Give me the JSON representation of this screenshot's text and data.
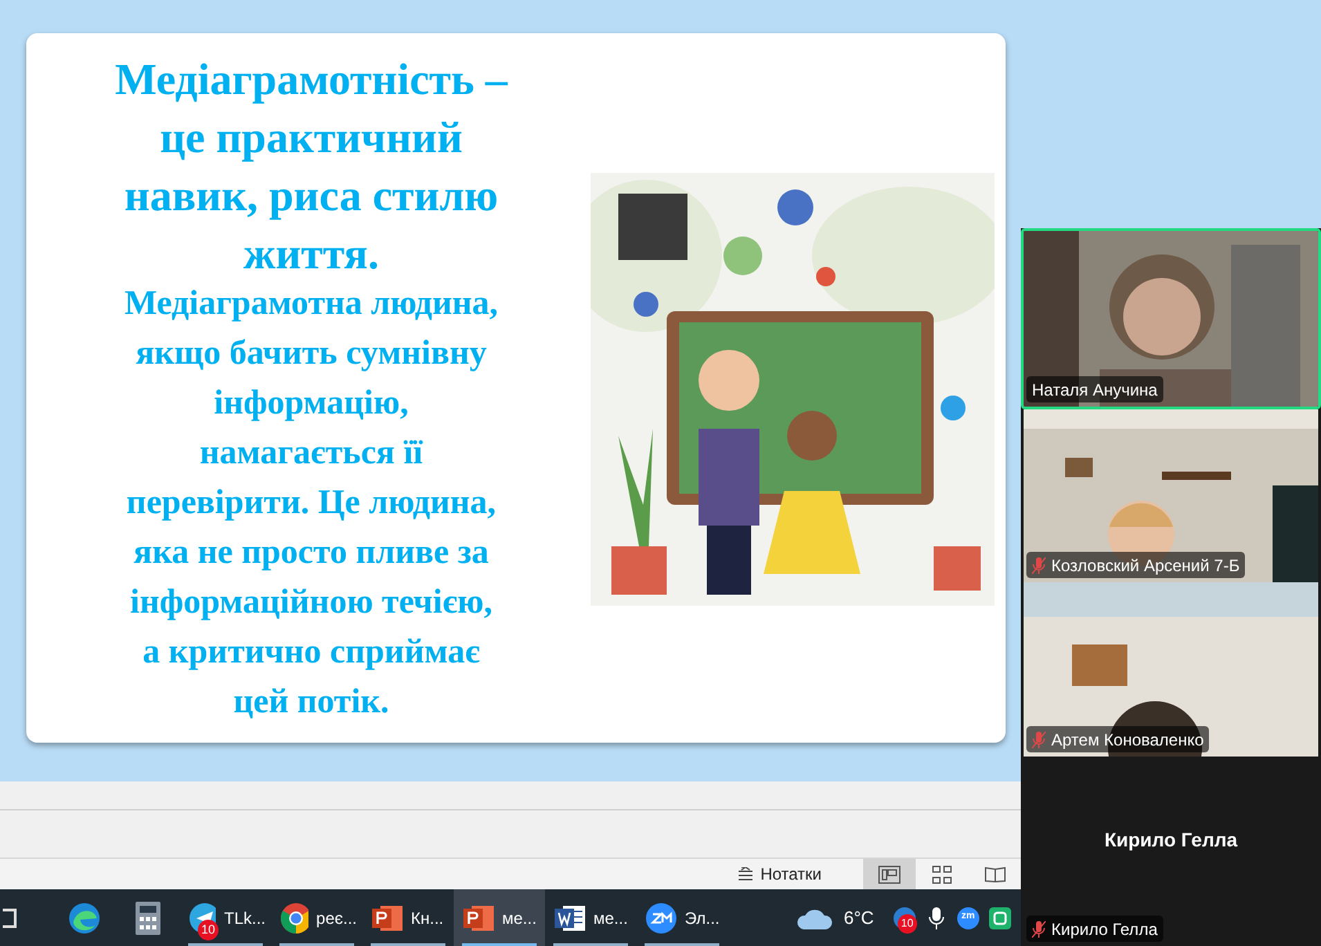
{
  "slide": {
    "heading_lines": [
      "Медіаграмотність –",
      "це практичний",
      "навик, риса стилю",
      "життя."
    ],
    "body_lines": [
      "Медіаграмотна людина,",
      "якщо бачить сумнівну",
      "інформацію,",
      "намагається її",
      "перевірити. Це людина,",
      "яка не просто пливе за",
      "інформаційною течією,",
      "а критично сприймає",
      "цей потік."
    ]
  },
  "status_bar": {
    "notes_label": "Нотатки",
    "views": [
      {
        "kind": "normal",
        "selected": true
      },
      {
        "kind": "sorter",
        "selected": false
      },
      {
        "kind": "reading",
        "selected": false
      }
    ]
  },
  "participants": [
    {
      "name": "Наталя Анучина",
      "muted": false,
      "speaking": true,
      "kind": "video"
    },
    {
      "name": "Козловский Арсений 7-Б",
      "muted": true,
      "speaking": false,
      "kind": "video"
    },
    {
      "name": "Артем Коноваленко",
      "muted": true,
      "speaking": false,
      "kind": "video"
    },
    {
      "name": "Кирило Гелла",
      "muted": true,
      "speaking": false,
      "kind": "no_video",
      "display_name": "Кирило Гелла"
    }
  ],
  "taskbar": [
    {
      "kind": "edge"
    },
    {
      "kind": "calculator"
    },
    {
      "kind": "telegram",
      "label": "TLk...",
      "badge": "10",
      "active": false
    },
    {
      "kind": "chrome",
      "label": "реє...",
      "active": false
    },
    {
      "kind": "powerpoint",
      "label": "Кн...",
      "active": false
    },
    {
      "kind": "powerpoint",
      "label": "ме...",
      "active": true
    },
    {
      "kind": "word",
      "label": "ме...",
      "active": false
    },
    {
      "kind": "zoom",
      "label": "Эл...",
      "active": false
    }
  ],
  "weather": {
    "temperature": "6°C"
  },
  "tray": [
    {
      "kind": "mail",
      "badge": "10"
    },
    {
      "kind": "mic"
    },
    {
      "kind": "zoom",
      "label": "zm"
    },
    {
      "kind": "green"
    }
  ]
}
